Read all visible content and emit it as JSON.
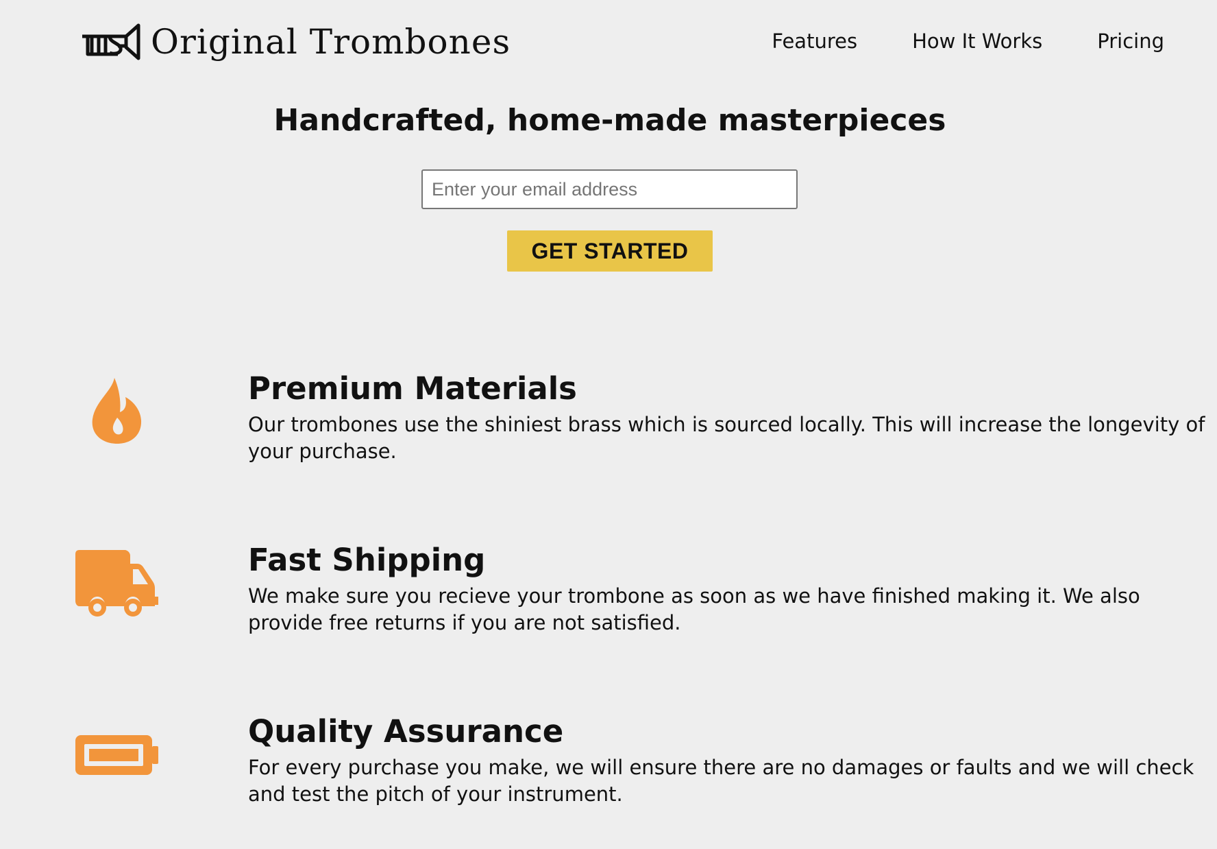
{
  "header": {
    "brand": "Original Trombones",
    "logo_icon": "trombone-icon",
    "nav": [
      {
        "label": "Features"
      },
      {
        "label": "How It Works"
      },
      {
        "label": "Pricing"
      }
    ]
  },
  "hero": {
    "title": "Handcrafted, home-made masterpieces",
    "email_placeholder": "Enter your email address",
    "email_value": "",
    "cta_label": "GET STARTED"
  },
  "features": [
    {
      "icon": "fire-icon",
      "title": "Premium Materials",
      "description": "Our trombones use the shiniest brass which is sourced locally. This will increase the longevity of your purchase."
    },
    {
      "icon": "truck-icon",
      "title": "Fast Shipping",
      "description": "We make sure you recieve your trombone as soon as we have finished making it. We also provide free returns if you are not satisfied."
    },
    {
      "icon": "battery-icon",
      "title": "Quality Assurance",
      "description": "For every purchase you make, we will ensure there are no damages or faults and we will check and test the pitch of your instrument."
    }
  ],
  "colors": {
    "background": "#eeeeee",
    "accent_button": "#e9c548",
    "icon_orange": "#f2953b",
    "text": "#111111"
  }
}
